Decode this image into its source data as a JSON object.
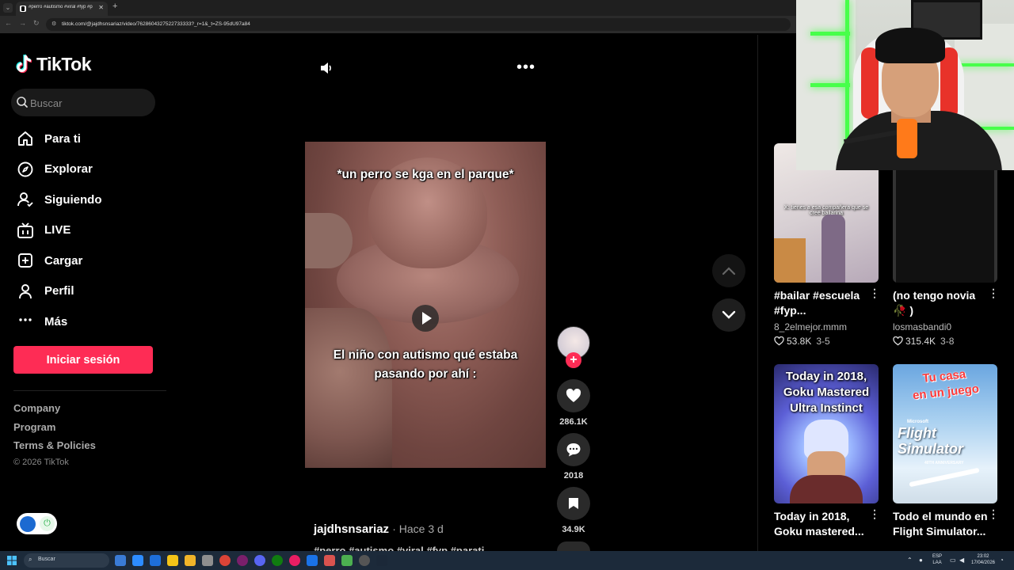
{
  "browser": {
    "tab_title": "#perro #autismo #viral #fyp #p",
    "url": "tiktok.com/@jajdhsnsariaz/video/7628604327522733333?_r=1&_t=ZS-95dU97a84"
  },
  "brand": {
    "name": "TikTok"
  },
  "search": {
    "placeholder": "Buscar"
  },
  "nav": [
    {
      "label": "Para ti",
      "icon": "home-icon"
    },
    {
      "label": "Explorar",
      "icon": "compass-icon"
    },
    {
      "label": "Siguiendo",
      "icon": "following-icon"
    },
    {
      "label": "LIVE",
      "icon": "live-icon"
    },
    {
      "label": "Cargar",
      "icon": "upload-icon"
    },
    {
      "label": "Perfil",
      "icon": "profile-icon"
    },
    {
      "label": "Más",
      "icon": "more-icon"
    }
  ],
  "login_label": "Iniciar sesión",
  "footer": {
    "links": [
      "Company",
      "Program",
      "Terms & Policies"
    ],
    "copyright": "© 2026 TikTok"
  },
  "video": {
    "caption_top": "*un perro se kga en el parque*",
    "caption_mid_1": "El niño con autismo qué estaba",
    "caption_mid_2": "pasando por ahí :",
    "likes": "286.1K",
    "comments": "2018",
    "saves": "34.9K",
    "author": "jajdhsnsariaz",
    "posted": "· Hace 3 d",
    "hashtags": "#perro #autismo #viral #fyp #parati"
  },
  "recommended": [
    {
      "title": "#bailar #escuela #fyp...",
      "author": "8_2elmejor.mmm",
      "likes": "53.8K",
      "part": "3-5",
      "thumb_text": "X: tienes a esa compañera que se creé bailarina"
    },
    {
      "title": "(no tengo novia 🥀 )",
      "author": "losmasbandi0",
      "likes": "315.4K",
      "part": "3-8",
      "thumb_text": ""
    },
    {
      "title": "Today in 2018, Goku mastered...",
      "author": "",
      "likes": "",
      "part": "",
      "thumb_text": "Today in 2018, Goku Mastered Ultra Instinct"
    },
    {
      "title": "Todo el mundo en Flight Simulator...",
      "author": "",
      "likes": "",
      "part": "",
      "thumb_text_1": "Tu casa",
      "thumb_text_2": "en un juego",
      "thumb_text_3": "Microsoft",
      "thumb_text_4": "Flight Simulator",
      "thumb_text_5": "40TH ANNIVERSARY"
    }
  ],
  "taskbar": {
    "search_placeholder": "Buscar",
    "lang_1": "ESP",
    "lang_2": "LAA",
    "time": "23:02",
    "date": "17/04/2026"
  },
  "colors": {
    "accent": "#fe2c55",
    "background": "#000000",
    "panel": "#1a1a1a"
  }
}
